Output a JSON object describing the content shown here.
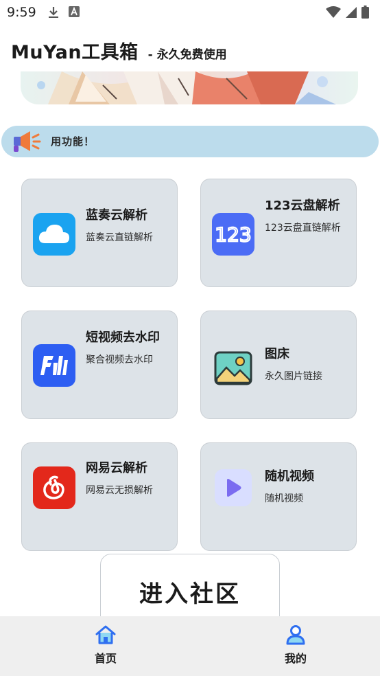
{
  "status_bar": {
    "time": "9:59",
    "left_icons": [
      "download-icon",
      "font-a-icon"
    ],
    "right_icons": [
      "wifi-icon",
      "signal-icon",
      "battery-icon"
    ]
  },
  "header": {
    "title": "MuYan工具箱",
    "subtitle": "- 永久免费使用"
  },
  "notice": {
    "text": "用功能！",
    "icon": "megaphone-icon"
  },
  "tools": [
    {
      "title": "蓝奏云解析",
      "desc": "蓝奏云直链解析",
      "icon": "cloud-icon",
      "color": "#1aa3f0"
    },
    {
      "title": "123云盘解析",
      "desc": "123云盘直链解析",
      "icon": "digits-123-icon",
      "color": "#4b6cf5"
    },
    {
      "title": "短视频去水印",
      "desc": "聚合视频去水印",
      "icon": "watermark-icon",
      "color": "#2d5ef2"
    },
    {
      "title": "图床",
      "desc": "永久图片链接",
      "icon": "image-icon",
      "color": "#6ed1c4"
    },
    {
      "title": "网易云解析",
      "desc": "网易云无损解析",
      "icon": "netease-music-icon",
      "color": "#e3281b"
    },
    {
      "title": "随机视频",
      "desc": "随机视频",
      "icon": "play-icon",
      "color": "#7b6cf0"
    }
  ],
  "community_button": "进入社区",
  "bottom_nav": {
    "home": "首页",
    "mine": "我的"
  }
}
